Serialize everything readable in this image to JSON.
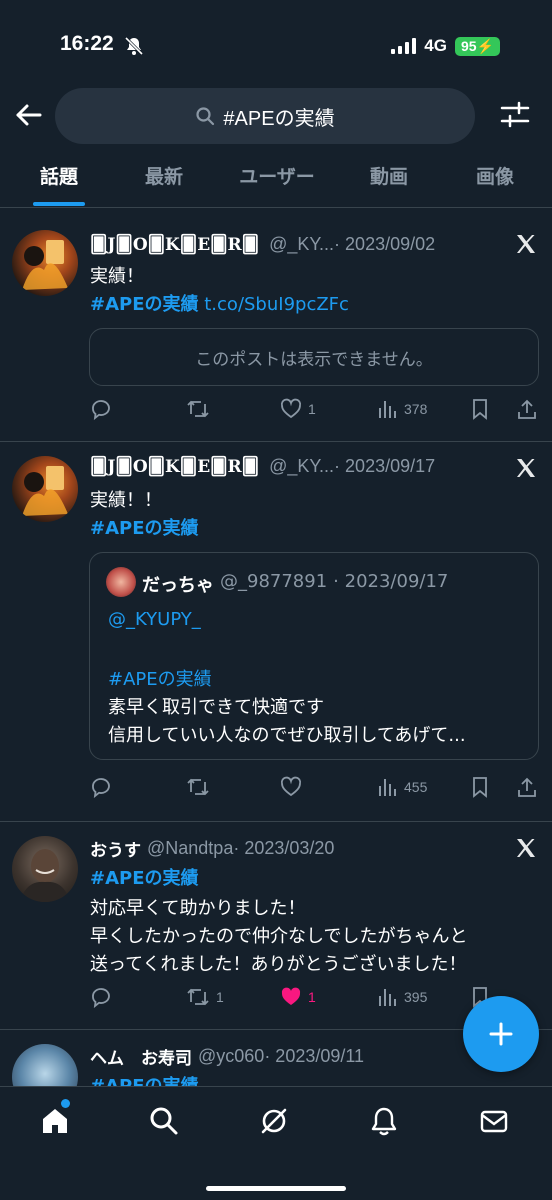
{
  "status": {
    "time": "16:22",
    "network": "4G",
    "battery": "95"
  },
  "search": {
    "query": "#APEの実績"
  },
  "tabs": [
    "話題",
    "最新",
    "ユーザー",
    "動画",
    "画像"
  ],
  "posts": [
    {
      "name": "🂠J🂠O🂠K🂠E🂠R🂠",
      "handle": "@_KY...",
      "date": "· 2023/09/02",
      "line1": "実績！",
      "hashtag": "#APEの実績",
      "link": "t.co/SbuI9pcZFc",
      "notice": "このポストは表示できません。",
      "reply": "",
      "retweet": "",
      "like": "1",
      "views": "378"
    },
    {
      "name": "🂠J🂠O🂠K🂠E🂠R🂠",
      "handle": "@_KY...",
      "date": "· 2023/09/17",
      "line1": "実績！！",
      "hashtag": "#APEの実績",
      "quote": {
        "name": "だっちゃ",
        "handle": "@_9877891",
        "date": "· 2023/09/17",
        "mention": "@_KYUPY_",
        "hashtag": "#APEの実績",
        "line1": "素早く取引できて快適です",
        "line2": "信用していい人なのでぜひ取引してあげて..."
      },
      "like": "",
      "views": "455"
    },
    {
      "name": "おうす",
      "handle": "@Nandtpa",
      "date": "· 2023/03/20",
      "hashtag": "#APEの実績",
      "line1": "対応早くて助かりました！",
      "line2": "早くしたかったので仲介なしでしたがちゃんと",
      "line3": "送ってくれました！ありがとうございました！",
      "retweet": "1",
      "like": "1",
      "views": "395"
    },
    {
      "name": "ヘム　お寿司",
      "handle": "@yc060",
      "date": "· 2023/09/11",
      "hashtag": "#APEの実績"
    }
  ],
  "colors": {
    "background": "#15202b",
    "accent": "#1d9bf0",
    "like_active": "#f91880",
    "muted": "#8b98a5"
  }
}
